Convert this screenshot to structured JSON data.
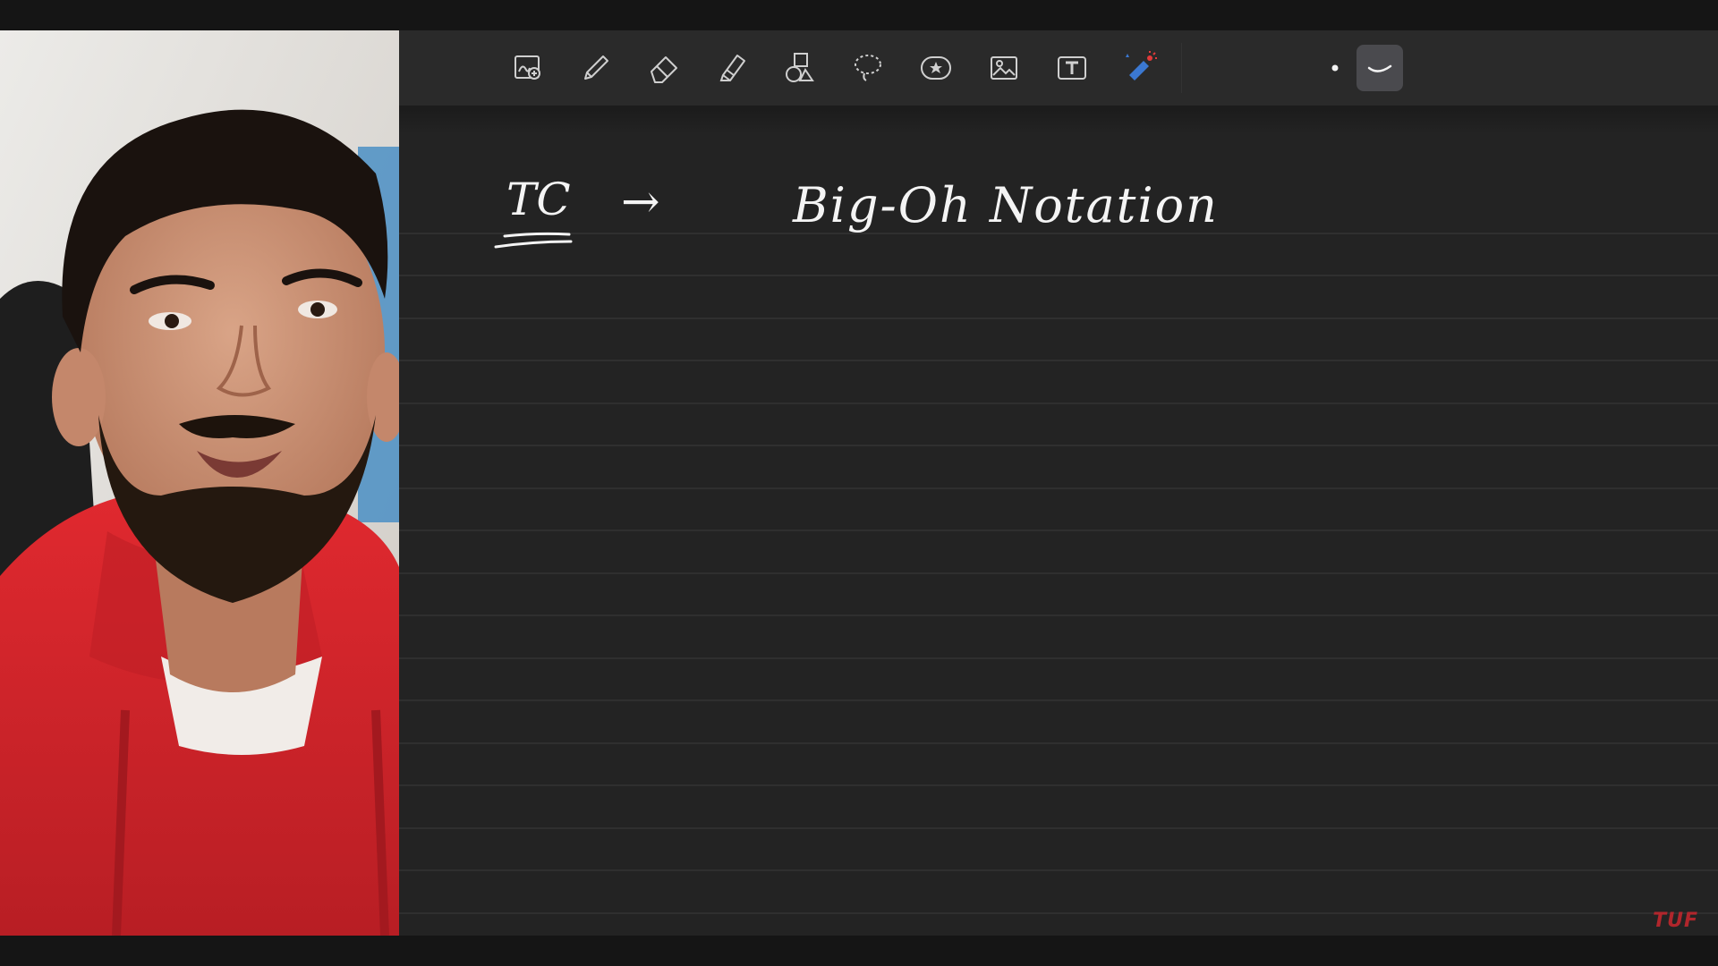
{
  "toolbar": {
    "tools": [
      {
        "name": "image-search-tool",
        "icon": "image-zoom-icon"
      },
      {
        "name": "pen-tool",
        "icon": "pen-icon"
      },
      {
        "name": "eraser-tool",
        "icon": "eraser-icon"
      },
      {
        "name": "highlighter-tool",
        "icon": "highlighter-icon"
      },
      {
        "name": "shapes-tool",
        "icon": "shapes-icon"
      },
      {
        "name": "lasso-tool",
        "icon": "lasso-icon"
      },
      {
        "name": "sticker-tool",
        "icon": "star-sticker-icon"
      },
      {
        "name": "image-tool",
        "icon": "image-icon"
      },
      {
        "name": "text-tool",
        "icon": "text-box-icon"
      },
      {
        "name": "laser-pointer-tool",
        "icon": "laser-pointer-icon"
      },
      {
        "name": "stroke-size-dot",
        "icon": "dot-icon"
      },
      {
        "name": "stroke-style-selected",
        "icon": "curve-stroke-icon",
        "selected": true
      }
    ]
  },
  "notes": {
    "line1_left": "TC",
    "arrow": "→",
    "line1_right": "Big-Oh Notation"
  },
  "watermark": {
    "text": "TUF",
    "color": "#c0272d"
  },
  "colors": {
    "canvas": "#232323",
    "toolbar": "#2a2a2a",
    "ink": "#f4f4f4",
    "hoodie": "#d4262c"
  }
}
